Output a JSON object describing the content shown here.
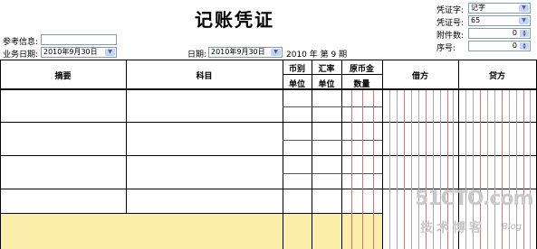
{
  "title": "记账凭证",
  "header": {
    "ref_label": "参考信息:",
    "ref_value": "",
    "business_date_label": "业务日期:",
    "business_date_value": "2010年9月30日",
    "date_label": "日期:",
    "date_value": "2010年9月30日",
    "period_text": "2010 年 第 9 期"
  },
  "right_panel": {
    "voucher_word_label": "凭证字:",
    "voucher_word_value": "记字",
    "voucher_no_label": "凭证号:",
    "voucher_no_value": "65",
    "attachments_label": "附件数:",
    "attachments_value": "0",
    "seq_label": "序号:",
    "seq_value": "0"
  },
  "table": {
    "col_summary": "摘要",
    "col_account": "科目",
    "col_currency": "币别",
    "col_rate": "汇率",
    "col_orig_amount": "原币金",
    "col_unit1": "单位",
    "col_unit2": "单位",
    "col_quantity": "数量",
    "col_debit": "借方",
    "col_credit": "贷方"
  },
  "watermark": {
    "line1": "51CTO.com",
    "line2": "技术博客",
    "line3": "Blog"
  }
}
